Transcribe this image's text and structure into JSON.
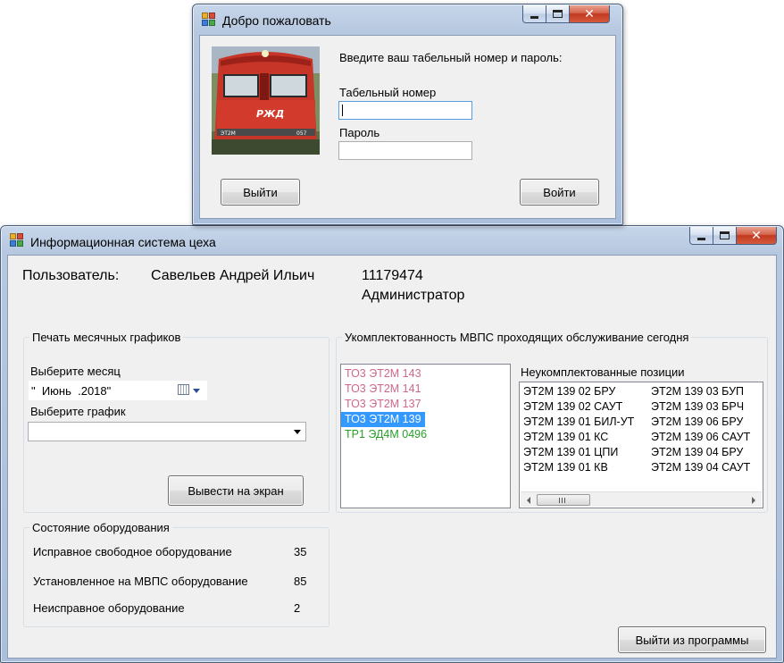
{
  "login_window": {
    "title": "Добро пожаловать",
    "prompt": "Введите ваш табельный номер и пароль:",
    "employee_number_label": "Табельный номер",
    "employee_number_value": "",
    "password_label": "Пароль",
    "password_value": "",
    "exit_button": "Выйти",
    "login_button": "Войти",
    "photo": {
      "logo_text": "РЖД",
      "model_text": "ЭТ2М",
      "number_text": "057"
    }
  },
  "main_window": {
    "title": "Информационная система цеха",
    "user": {
      "label": "Пользователь:",
      "name": "Савельев Андрей Ильич",
      "employee_number": "11179474",
      "role": "Администратор"
    },
    "print_group": {
      "title": "Печать месячных графиков",
      "month_label": "Выберите месяц",
      "month_value": "\"  Июнь  .2018\"",
      "schedule_label": "Выберите график",
      "schedule_value": "",
      "show_button": "Вывести на экран"
    },
    "equipment_group": {
      "title": "Состояние оборудования",
      "rows": [
        {
          "label": "Исправное свободное оборудование",
          "value": "35"
        },
        {
          "label": "Установленное на МВПС оборудование",
          "value": "85"
        },
        {
          "label": "Неисправное оборудование",
          "value": "2"
        }
      ]
    },
    "completeness_group": {
      "title": "Укомплектованность МВПС проходящих обслуживание сегодня",
      "trains": [
        {
          "label": "ТО3 ЭТ2М 143",
          "color": "#d0668a",
          "selected": false
        },
        {
          "label": "ТО3 ЭТ2М 141",
          "color": "#d0668a",
          "selected": false
        },
        {
          "label": "ТО3 ЭТ2М 137",
          "color": "#d0668a",
          "selected": false
        },
        {
          "label": "ТО3 ЭТ2М 139",
          "color": "#ffffff",
          "selected": true
        },
        {
          "label": "ТР1 ЭД4М 0496",
          "color": "#27a02a",
          "selected": false
        }
      ],
      "incomplete_label": "Неукомплектованные позиции",
      "incomplete_columns": [
        [
          "ЭТ2М 139 02 БРУ",
          "ЭТ2М 139 02 САУТ",
          "ЭТ2М 139 01 БИЛ-УТ",
          "ЭТ2М 139 01 КС",
          "ЭТ2М 139 01 ЦПИ",
          "ЭТ2М 139 01 КВ"
        ],
        [
          "ЭТ2М 139 03 БУП",
          "ЭТ2М 139 03 БРЧ",
          "ЭТ2М 139 06 БРУ",
          "ЭТ2М 139 06 САУТ",
          "ЭТ2М 139 04 БРУ",
          "ЭТ2М 139 04 САУТ"
        ]
      ]
    },
    "exit_program_button": "Выйти из программы"
  }
}
